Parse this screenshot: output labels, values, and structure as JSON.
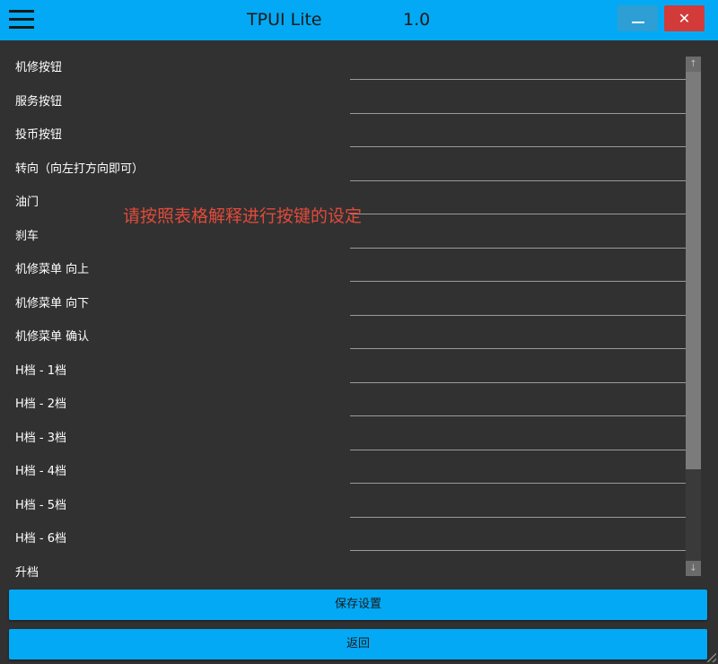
{
  "window": {
    "title": "TPUI Lite",
    "version": "1.0",
    "menu_icon": "hamburger-menu-icon",
    "minimize_icon": "minimize-icon",
    "close_icon": "close-icon",
    "close_glyph": "✕"
  },
  "hint_text": "请按照表格解释进行按键的设定",
  "bindings": [
    {
      "label": "机修按钮",
      "value": ""
    },
    {
      "label": "服务按钮",
      "value": ""
    },
    {
      "label": "投币按钮",
      "value": ""
    },
    {
      "label": "转向（向左打方向即可）",
      "value": ""
    },
    {
      "label": "油门",
      "value": ""
    },
    {
      "label": "刹车",
      "value": ""
    },
    {
      "label": "机修菜单 向上",
      "value": ""
    },
    {
      "label": "机修菜单 向下",
      "value": ""
    },
    {
      "label": "机修菜单 确认",
      "value": ""
    },
    {
      "label": "H档 - 1档",
      "value": ""
    },
    {
      "label": "H档 - 2档",
      "value": ""
    },
    {
      "label": "H档 - 3档",
      "value": ""
    },
    {
      "label": "H档 - 4档",
      "value": ""
    },
    {
      "label": "H档 - 5档",
      "value": ""
    },
    {
      "label": "H档 - 6档",
      "value": ""
    },
    {
      "label": "升档",
      "value": ""
    }
  ],
  "scrollbar": {
    "up_glyph": "↑",
    "down_glyph": "↓"
  },
  "actions": {
    "save_label": "保存设置",
    "back_label": "返回"
  },
  "colors": {
    "accent": "#03a9f4",
    "background": "#313131",
    "close": "#d33a3a",
    "hint": "#e24a3a"
  }
}
